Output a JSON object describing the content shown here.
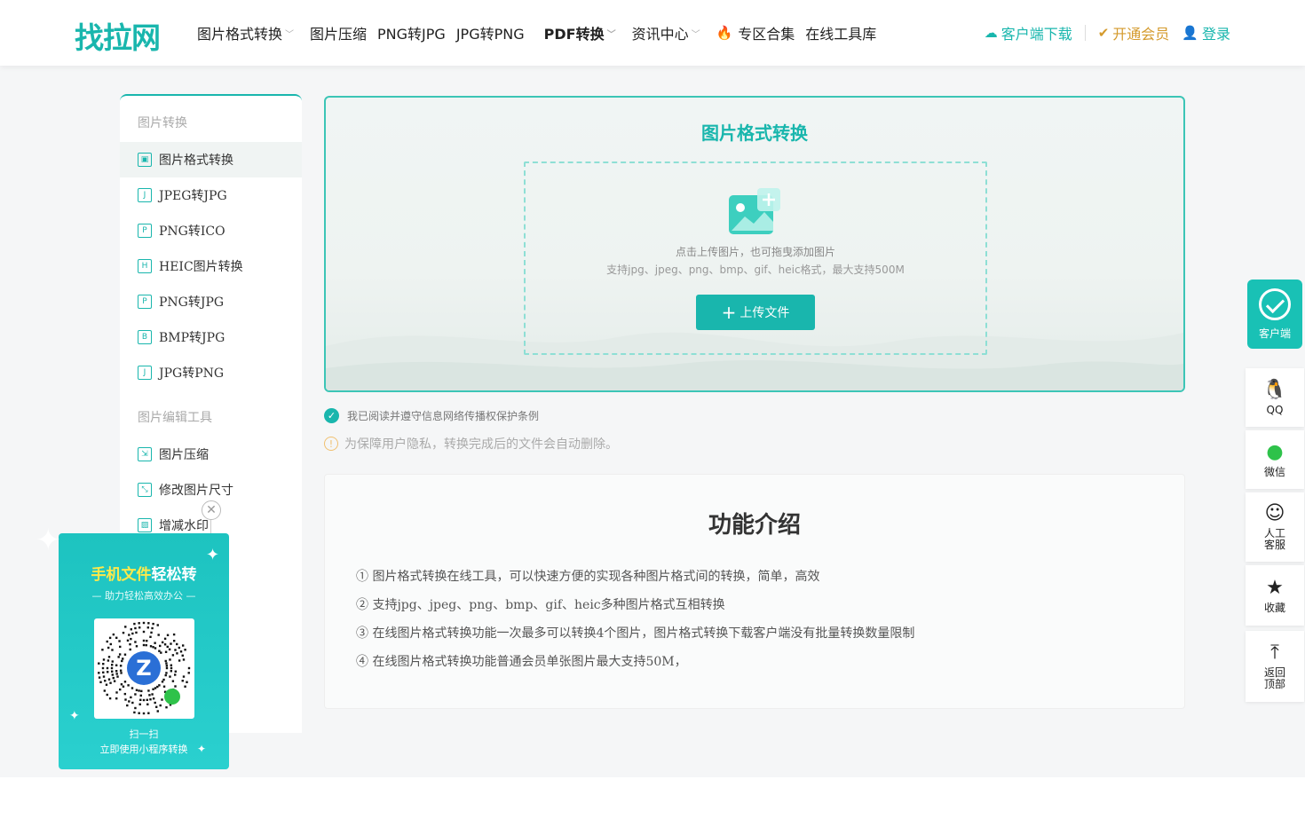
{
  "header": {
    "logo": "找拉网",
    "nav": [
      {
        "label": "图片格式转换",
        "dropdown": true,
        "bold": false
      },
      {
        "label": "图片压缩",
        "dropdown": false,
        "bold": false
      },
      {
        "label": "PNG转JPG",
        "dropdown": false,
        "bold": false
      },
      {
        "label": "JPG转PNG",
        "dropdown": false,
        "bold": false
      },
      {
        "label": "PDF转换",
        "dropdown": true,
        "bold": true
      },
      {
        "label": "资讯中心",
        "dropdown": true,
        "bold": false
      },
      {
        "label": "专区合集",
        "dropdown": false,
        "bold": false,
        "icon": "fire-icon"
      },
      {
        "label": "在线工具库",
        "dropdown": false,
        "bold": false
      }
    ],
    "client_download": "客户端下载",
    "vip": "开通会员",
    "login": "登录"
  },
  "sidebar": {
    "section1": "图片转换",
    "items1": [
      {
        "label": "图片格式转换",
        "icon": "image-icon",
        "glyph": "▣"
      },
      {
        "label": "JPEG转JPG",
        "icon": "j-file-icon",
        "glyph": "J"
      },
      {
        "label": "PNG转ICO",
        "icon": "p-file-icon",
        "glyph": "P"
      },
      {
        "label": "HEIC图片转换",
        "icon": "h-file-icon",
        "glyph": "H"
      },
      {
        "label": "PNG转JPG",
        "icon": "p-file-icon",
        "glyph": "P"
      },
      {
        "label": "BMP转JPG",
        "icon": "b-file-icon",
        "glyph": "B"
      },
      {
        "label": "JPG转PNG",
        "icon": "j-file-icon",
        "glyph": "J"
      }
    ],
    "section2": "图片编辑工具",
    "items2": [
      {
        "label": "图片压缩",
        "icon": "compress-icon",
        "glyph": "⇲"
      },
      {
        "label": "修改图片尺寸",
        "icon": "resize-icon",
        "glyph": "⤡"
      },
      {
        "label": "增减水印",
        "icon": "watermark-icon",
        "glyph": "▨"
      }
    ]
  },
  "upload": {
    "title": "图片格式转换",
    "hint1": "点击上传图片，也可拖曳添加图片",
    "hint2": "支持jpg、jpeg、png、bmp、gif、heic格式，最大支持500M",
    "button": "上传文件"
  },
  "agreement": "我已阅读并遵守信息网络传播权保护条例",
  "privacy": "为保障用户隐私，转换完成后的文件会自动删除。",
  "intro": {
    "title": "功能介绍",
    "items": [
      "① 图片格式转换在线工具，可以快速方便的实现各种图片格式间的转换，简单，高效",
      "② 支持jpg、jpeg、png、bmp、gif、heic多种图片格式互相转换",
      "③ 在线图片格式转换功能一次最多可以转换4个图片，图片格式转换下载客户端没有批量转换数量限制",
      "④ 在线图片格式转换功能普通会员单张图片最大支持50M，"
    ]
  },
  "float_bar": {
    "client": "客户端",
    "qq": "QQ",
    "wechat": "微信",
    "service": [
      "人工",
      "客服"
    ],
    "favorite": "收藏",
    "top": [
      "返回",
      "顶部"
    ]
  },
  "promo": {
    "title_highlight": "手机文件",
    "title_rest": "轻松转",
    "subtitle": "— 助力轻松高效办公 —",
    "qr_letter": "Z",
    "line1": "扫一扫",
    "line2": "立即使用小程序转换"
  },
  "colors": {
    "brand": "#19b6ad",
    "gold": "#d49a2c",
    "promo_yellow": "#fde94b"
  }
}
